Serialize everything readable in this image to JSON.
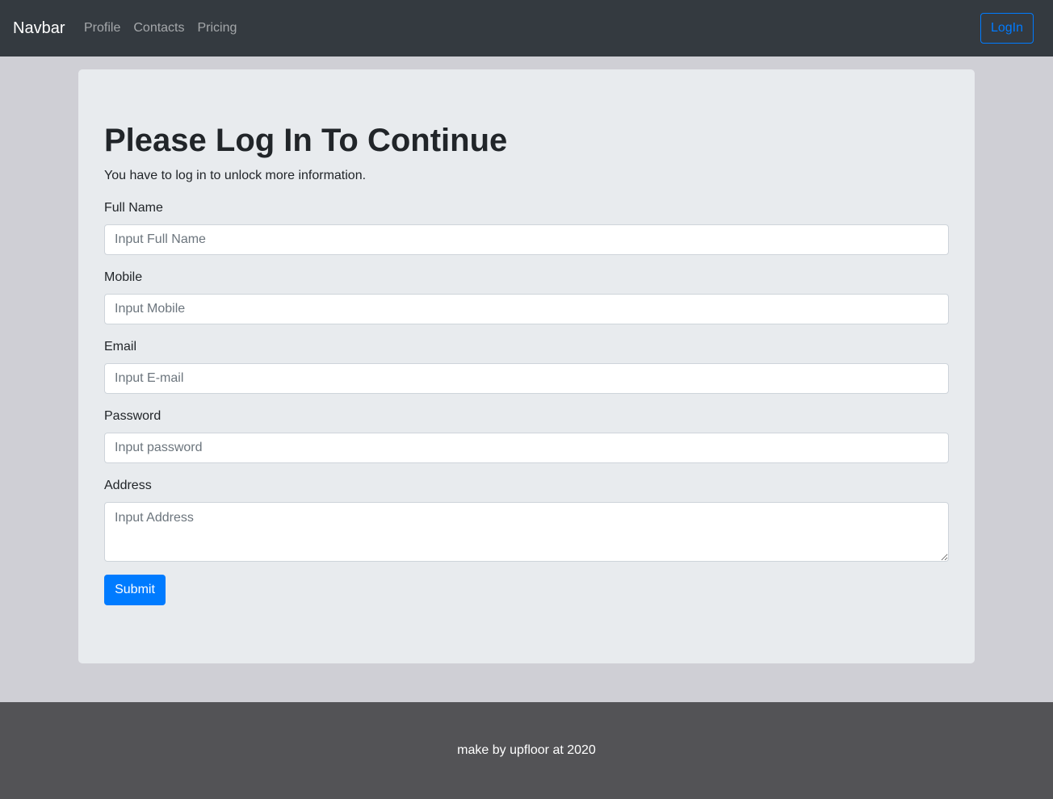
{
  "navbar": {
    "brand": "Navbar",
    "links": [
      "Profile",
      "Contacts",
      "Pricing"
    ],
    "login_label": "LogIn"
  },
  "form": {
    "title": "Please Log In To Continue",
    "subtitle": "You have to log in to unlock more information.",
    "fields": [
      {
        "label": "Full Name",
        "placeholder": "Input Full Name",
        "value": ""
      },
      {
        "label": "Mobile",
        "placeholder": "Input Mobile",
        "value": ""
      },
      {
        "label": "Email",
        "placeholder": "Input E-mail",
        "value": ""
      },
      {
        "label": "Password",
        "placeholder": "Input password",
        "value": ""
      },
      {
        "label": "Address",
        "placeholder": "Input Address",
        "value": ""
      }
    ],
    "submit_label": "Submit"
  },
  "footer": {
    "text": "make by upfloor at 2020"
  },
  "colors": {
    "navbar_bg": "#343a40",
    "primary": "#007bff",
    "card_bg": "#e8ebee",
    "page_bg": "#cfcfd5",
    "footer_bg": "#535356"
  }
}
